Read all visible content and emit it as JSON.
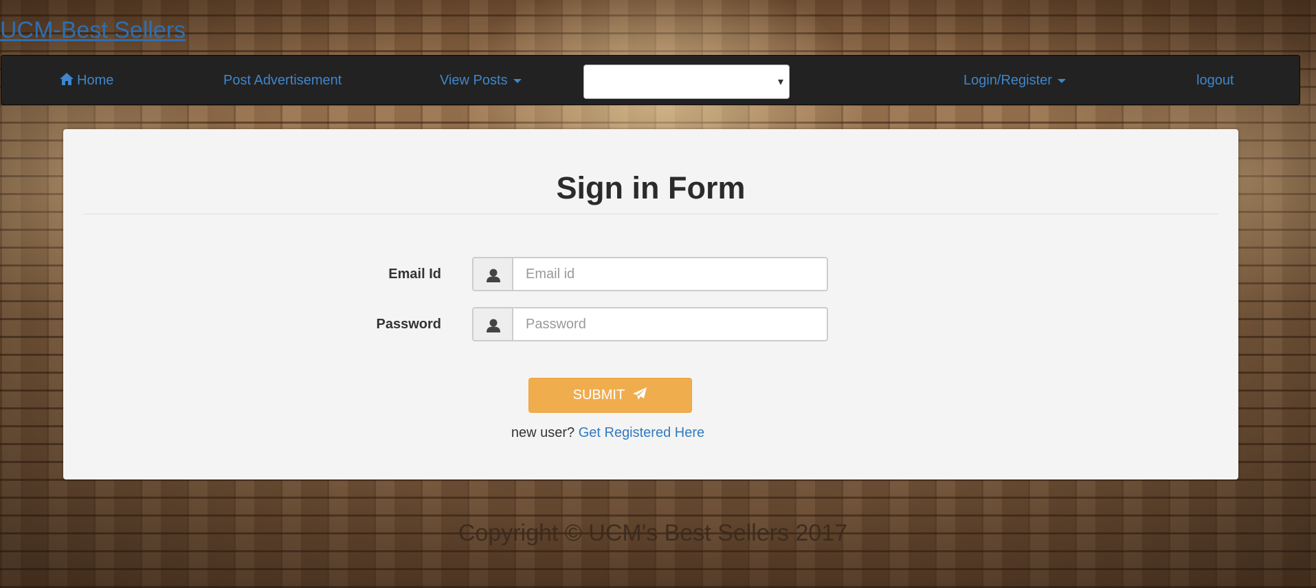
{
  "brand": {
    "title": "UCM-Best Sellers"
  },
  "nav": {
    "home": "Home",
    "post_ad": "Post Advertisement",
    "view_posts": "View Posts",
    "select_value": "",
    "login_register": "Login/Register",
    "logout": "logout"
  },
  "form": {
    "title": "Sign in Form",
    "email_label": "Email Id",
    "email_placeholder": "Email id",
    "password_label": "Password",
    "password_placeholder": "Password",
    "submit_label": "SUBMIT",
    "new_user_text": "new user?",
    "register_link": "Get Registered Here"
  },
  "footer": {
    "text": "Copyright © UCM's Best Sellers 2017"
  },
  "colors": {
    "link": "#3f86cc",
    "navbar": "#222222",
    "submit": "#f0ad4e",
    "panel": "#f4f4f4"
  },
  "icons": {
    "home": "home-icon",
    "user": "user-icon",
    "submit": "paper-plane-icon",
    "select": "chevron-down-icon"
  }
}
